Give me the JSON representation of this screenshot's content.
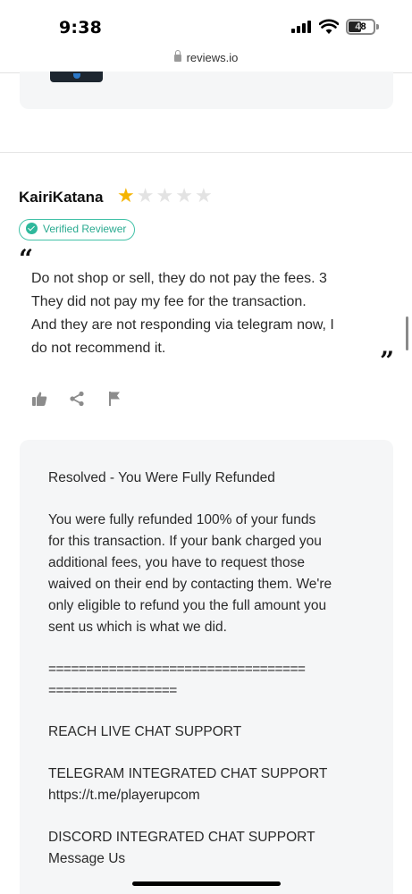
{
  "status_bar": {
    "time": "9:38",
    "battery": "48"
  },
  "browser": {
    "url": "reviews.io"
  },
  "review": {
    "reviewer": "KairiKatana",
    "rating": 1,
    "max_rating": 5,
    "verified_label": "Verified Reviewer",
    "quote_open": "“",
    "quote_close": "”",
    "body_lines": [
      "Do not shop or sell, they do not pay the fees. 3",
      "They did not pay my fee for the transaction.",
      "And they are not responding via telegram now, I",
      "do not recommend it."
    ]
  },
  "actions": {
    "like_icon": "thumbs-up-icon",
    "share_icon": "share-icon",
    "flag_icon": "flag-icon"
  },
  "reply": {
    "title": "Resolved - You Were Fully Refunded",
    "body_lines": [
      "You were fully refunded 100% of your funds",
      "for this transaction. If your bank charged you",
      "additional fees, you have to request those",
      "waived on their end by contacting them. We're",
      "only eligible to refund you the full amount you",
      "sent us which is what we did."
    ],
    "separator_1": "==================================",
    "separator_2": "=================",
    "live_chat": "REACH LIVE CHAT SUPPORT",
    "telegram_label": "TELEGRAM INTEGRATED CHAT SUPPORT",
    "telegram_url": "https://t.me/playerupcom",
    "discord_label": "DISCORD INTEGRATED CHAT SUPPORT",
    "discord_sub": "Message Us"
  },
  "colors": {
    "star": "#f5b400",
    "verified": "#2fb89c",
    "card_bg": "#f5f6f7"
  }
}
